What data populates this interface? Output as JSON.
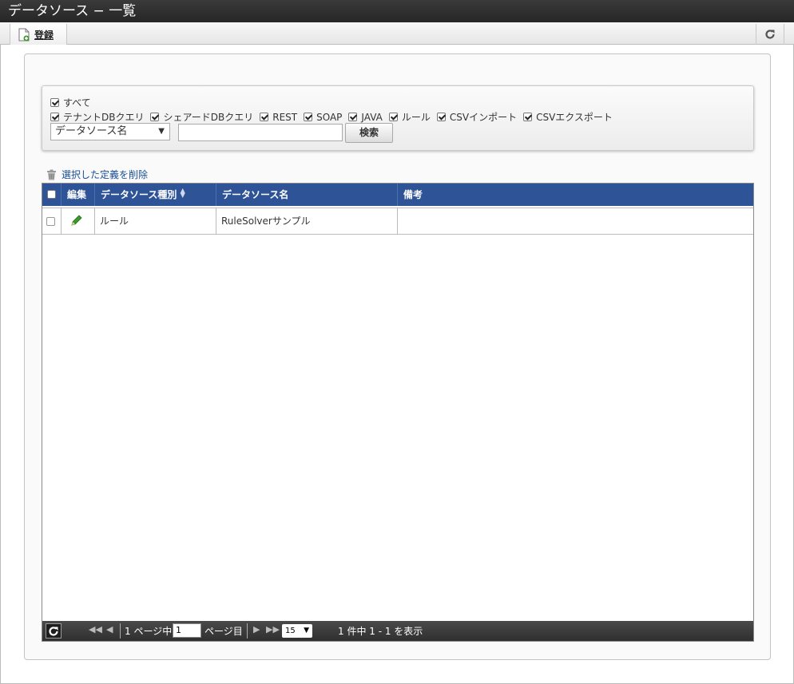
{
  "window": {
    "title": "データソース − 一覧"
  },
  "toolbar": {
    "register_label": "登録"
  },
  "filters": {
    "all_label": "すべて",
    "types": [
      {
        "label": "テナントDBクエリ",
        "checked": true
      },
      {
        "label": "シェアードDBクエリ",
        "checked": true
      },
      {
        "label": "REST",
        "checked": true
      },
      {
        "label": "SOAP",
        "checked": true
      },
      {
        "label": "JAVA",
        "checked": true
      },
      {
        "label": "ルール",
        "checked": true
      },
      {
        "label": "CSVインポート",
        "checked": true
      },
      {
        "label": "CSVエクスポート",
        "checked": true
      }
    ],
    "search_field": "データソース名",
    "search_value": "",
    "search_button": "検索"
  },
  "actions": {
    "delete_selected": "選択した定義を削除"
  },
  "grid": {
    "columns": {
      "edit": "編集",
      "type": "データソース種別",
      "name": "データソース名",
      "note": "備考"
    },
    "rows": [
      {
        "type": "ルール",
        "name": "RuleSolverサンプル",
        "note": ""
      }
    ]
  },
  "pager": {
    "page_prefix": "1 ページ中",
    "page_value": "1",
    "page_suffix": "ページ目",
    "page_size": "15",
    "summary": "1 件中 1 - 1 を表示"
  },
  "colors": {
    "header_blue": "#2e5397",
    "titlebar": "#2b2b2b",
    "link": "#1a4f93",
    "edit_icon": "#3a9a2a"
  }
}
